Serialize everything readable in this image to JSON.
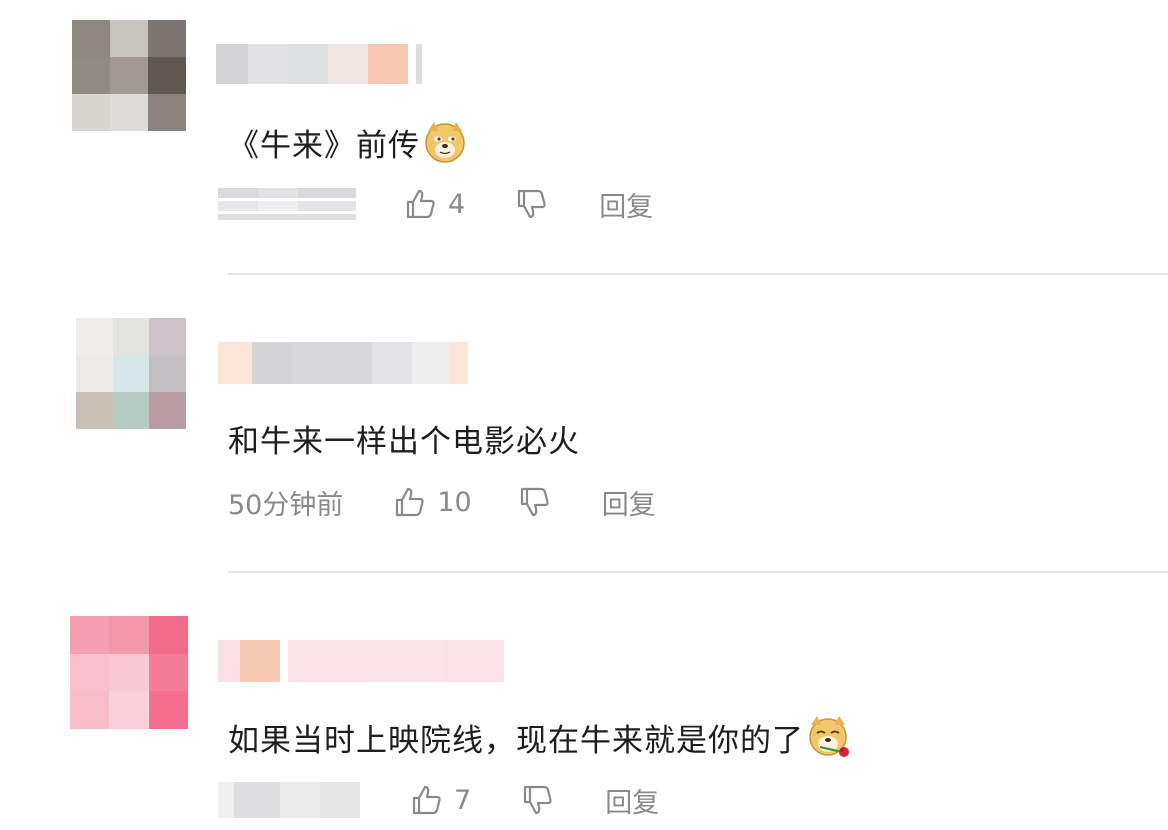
{
  "comments": [
    {
      "text": "《牛来》前传",
      "emoji": "doge-face-icon",
      "time": "",
      "likes": "4",
      "reply_label": "回复",
      "avatar_colors": [
        "#8f8880",
        "#c8c5c0",
        "#7c7571",
        "#908b83",
        "#a09a92",
        "#5f5853",
        "#d9d6d2",
        "#dedcd9",
        "#8b837d"
      ],
      "username_colors": [
        "#d6d6d8",
        "#e2e2e4",
        "#dfe0e2",
        "#efe6e1",
        "#f6c7b0"
      ]
    },
    {
      "text": "和牛来一样出个电影必火",
      "emoji": "",
      "time": "50分钟前",
      "likes": "10",
      "reply_label": "回复",
      "avatar_colors": [
        "#efecea",
        "#e3e4e2",
        "#cfc2c8",
        "#ece9e6",
        "#d8e6ea",
        "#c3bfc2",
        "#c9c1b6",
        "#b7cbc3",
        "#b89ca3"
      ],
      "username_colors": [
        "#fbe5d9",
        "#d5d5d7",
        "#d9d9db",
        "#e3e3e5",
        "#ededee",
        "#fbe5d9"
      ]
    },
    {
      "text": "如果当时上映院线，现在牛来就是你的了",
      "emoji": "doge-rose-icon",
      "time": "",
      "likes": "7",
      "reply_label": "回复",
      "avatar_colors": [
        "#f5a0b2",
        "#f497ab",
        "#f26b8a",
        "#f9c0cf",
        "#fac8d5",
        "#f47c99",
        "#f9bccb",
        "#fbd0da",
        "#f56e8d"
      ],
      "username_colors": [
        "#fbe0e5",
        "#f8cbb7",
        "#fbe2e8",
        "#fce5ea",
        "#fbe2e8",
        "#fbe2e8"
      ]
    }
  ]
}
